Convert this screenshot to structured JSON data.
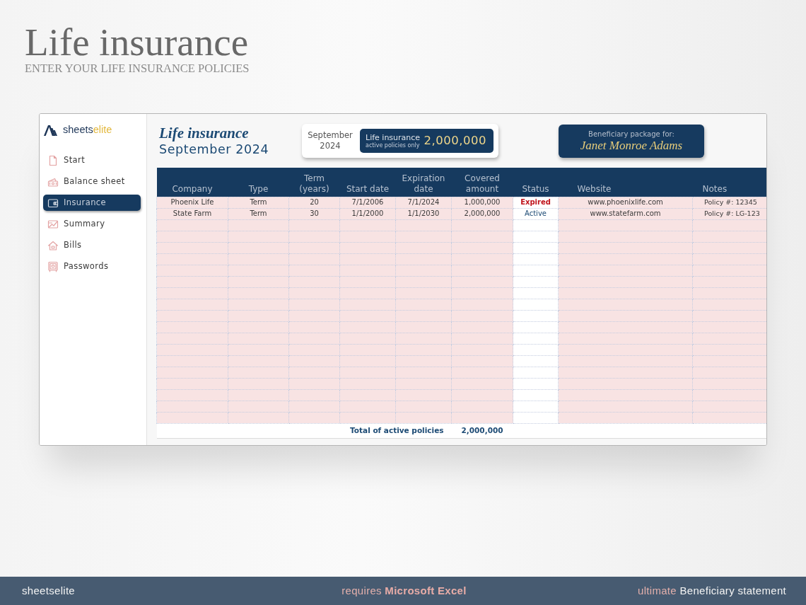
{
  "page": {
    "title": "Life insurance",
    "subtitle": "ENTER YOUR LIFE INSURANCE POLICIES"
  },
  "sidebar": {
    "logo": {
      "name_start": "sheets",
      "name_end": "elite"
    },
    "items": [
      {
        "label": "Start",
        "selected": false
      },
      {
        "label": "Balance sheet",
        "selected": false
      },
      {
        "label": "Insurance",
        "selected": true
      },
      {
        "label": "Summary",
        "selected": false
      },
      {
        "label": "Bills",
        "selected": false
      },
      {
        "label": "Passwords",
        "selected": false
      }
    ]
  },
  "header": {
    "title": "Life insurance",
    "period": "September 2024",
    "summary": {
      "date": "September 2024",
      "label": "Life insurance",
      "note": "active policies only",
      "amount": "2,000,000"
    },
    "beneficiary": {
      "label": "Beneficiary package for:",
      "name": "Janet Monroe Adams"
    }
  },
  "table": {
    "columns": [
      "Company",
      "Type",
      "Term (years)",
      "Start date",
      "Expiration date",
      "Covered amount",
      "Status",
      "Website",
      "Notes"
    ],
    "rows": [
      {
        "cells": [
          "Phoenix Life",
          "Term",
          "20",
          "7/1/2006",
          "7/1/2024",
          "1,000,000",
          "Expired",
          "www.phoenixlife.com",
          "Policy #: 12345"
        ],
        "expired": true
      },
      {
        "cells": [
          "State Farm",
          "Term",
          "30",
          "1/1/2000",
          "1/1/2030",
          "2,000,000",
          "Active",
          "www.statefarm.com",
          "Policy #: LG-123"
        ],
        "expired": false
      }
    ],
    "total": {
      "label": "Total of active policies",
      "amount": "2,000,000"
    }
  },
  "footer_bar": {
    "brand": "sheetselite",
    "requirement_prefix": "requires",
    "requirement": "Microsoft Excel",
    "edition_prefix": "ultimate",
    "edition": "Beneficiary statement"
  }
}
